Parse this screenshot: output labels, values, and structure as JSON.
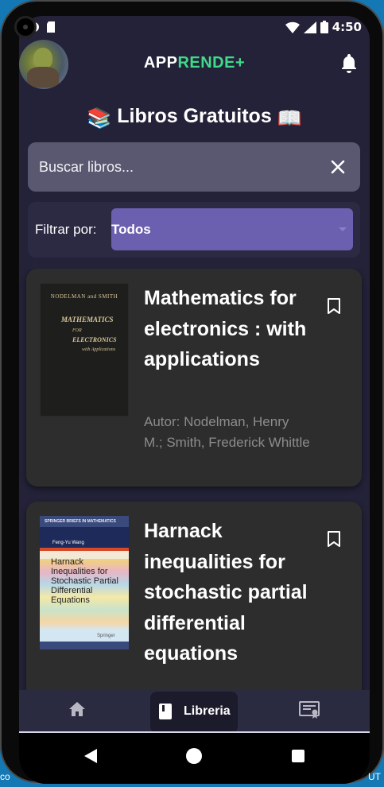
{
  "status_bar": {
    "time": "4:50"
  },
  "app_bar": {
    "brand_part1": "APP",
    "brand_part2": "RENDE+"
  },
  "page": {
    "title_icon": "📚",
    "title": "Libros Gratuitos",
    "title_trail_icon": "📖"
  },
  "search": {
    "placeholder": "Buscar libros...",
    "value": ""
  },
  "filter": {
    "label": "Filtrar por:",
    "selected": "Todos"
  },
  "books": [
    {
      "title": "Mathematics for electronics : with applications",
      "author": "Autor: Nodelman, Henry M.; Smith, Frederick Whittle",
      "cover": {
        "author_line": "NODELMAN and SMITH",
        "line1": "MATHEMATICS",
        "line2": "FOR",
        "line3": "ELECTRONICS",
        "line4": "with Applications"
      }
    },
    {
      "title": "Harnack inequalities for stochastic partial differential equations",
      "author": "",
      "cover": {
        "series": "SPRINGER BRIEFS IN MATHEMATICS",
        "author_line": "Feng-Yu Wang",
        "title_text": "Harnack Inequalities for Stochastic Partial Differential Equations",
        "publisher": "Springer"
      }
    }
  ],
  "bottom_nav": {
    "library_label": "Libreria"
  },
  "edge_text": {
    "left": "co",
    "right": "UT"
  },
  "colors": {
    "background": "#232238",
    "accent": "#41d98a",
    "select": "#6b5fb0",
    "card": "#2d2d2d"
  }
}
